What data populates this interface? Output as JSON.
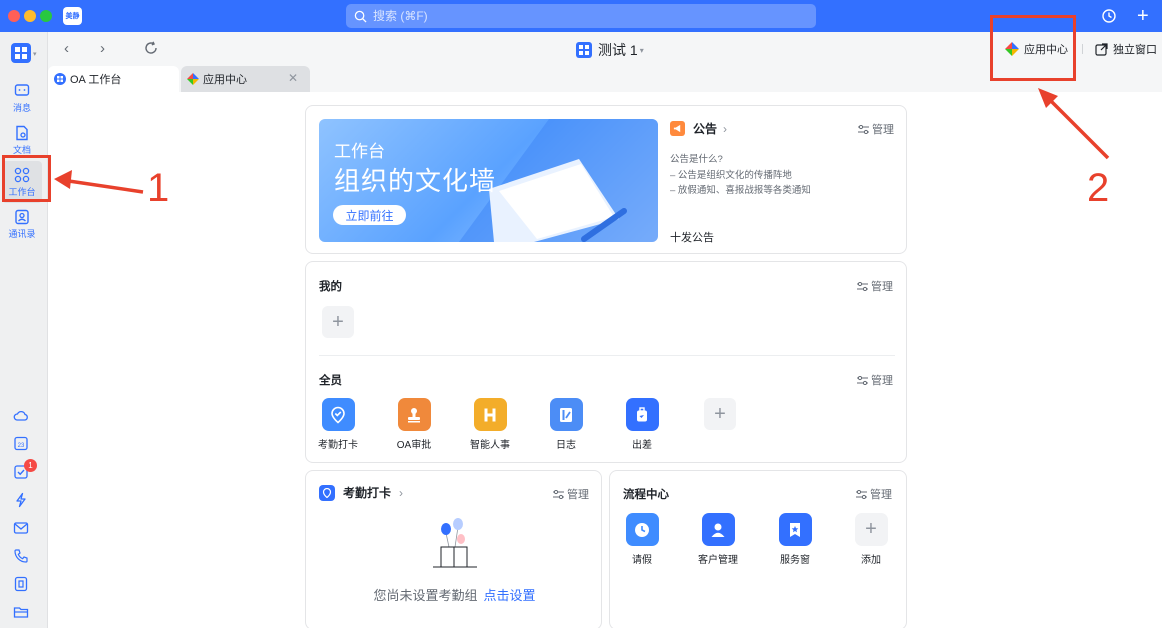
{
  "titlebar": {
    "app_logo_text": "美静",
    "search_placeholder": "搜索 (⌘F)",
    "colors": {
      "bar": "#3370ff"
    }
  },
  "rail": {
    "items": [
      {
        "label": "消息",
        "icon": "message-icon"
      },
      {
        "label": "文档",
        "icon": "docs-icon"
      },
      {
        "label": "工作台",
        "icon": "workbench-icon",
        "active": true
      },
      {
        "label": "通讯录",
        "icon": "contacts-icon"
      }
    ],
    "bottom_icons": [
      "cloud-drive-icon",
      "calendar-icon",
      "tasks-icon",
      "lightning-icon",
      "mail-icon",
      "phone-icon",
      "wiki-icon",
      "folder-icon"
    ],
    "calendar_day": "23",
    "tasks_badge": "1"
  },
  "navbar": {
    "page_title": "测试 1",
    "app_center_label": "应用中心",
    "standalone_label": "独立窗口"
  },
  "tabs": [
    {
      "label": "OA 工作台",
      "active": true
    },
    {
      "label": "应用中心",
      "active": false
    }
  ],
  "banner": {
    "subtitle": "工作台",
    "title": "组织的文化墙",
    "button": "立即前往"
  },
  "announcement": {
    "title": "公告",
    "manage": "管理",
    "desc": [
      "公告是什么?",
      "– 公告是组织文化的传播阵地",
      "– 放假通知、喜报战报等各类通知"
    ],
    "post": "十发公告"
  },
  "mine": {
    "title": "我的",
    "manage": "管理"
  },
  "all": {
    "title": "全员",
    "manage": "管理",
    "apps": [
      {
        "name": "考勤打卡",
        "color": "#3f8cff"
      },
      {
        "name": "OA审批",
        "color": "#f0893b"
      },
      {
        "name": "智能人事",
        "color": "#f3ad2a"
      },
      {
        "name": "日志",
        "color": "#4c8df6"
      },
      {
        "name": "出差",
        "color": "#3370ff"
      }
    ]
  },
  "attendance": {
    "title": "考勤打卡",
    "manage": "管理",
    "empty_text": "您尚未设置考勤组",
    "setup_link": "点击设置"
  },
  "flow": {
    "title": "流程中心",
    "manage": "管理",
    "apps": [
      {
        "name": "请假",
        "color": "#3f8cff"
      },
      {
        "name": "客户管理",
        "color": "#3370ff"
      },
      {
        "name": "服务窗",
        "color": "#3370ff"
      },
      {
        "name": "添加"
      }
    ]
  },
  "annotations": {
    "n1": "1",
    "n2": "2",
    "color": "#e8412c"
  }
}
